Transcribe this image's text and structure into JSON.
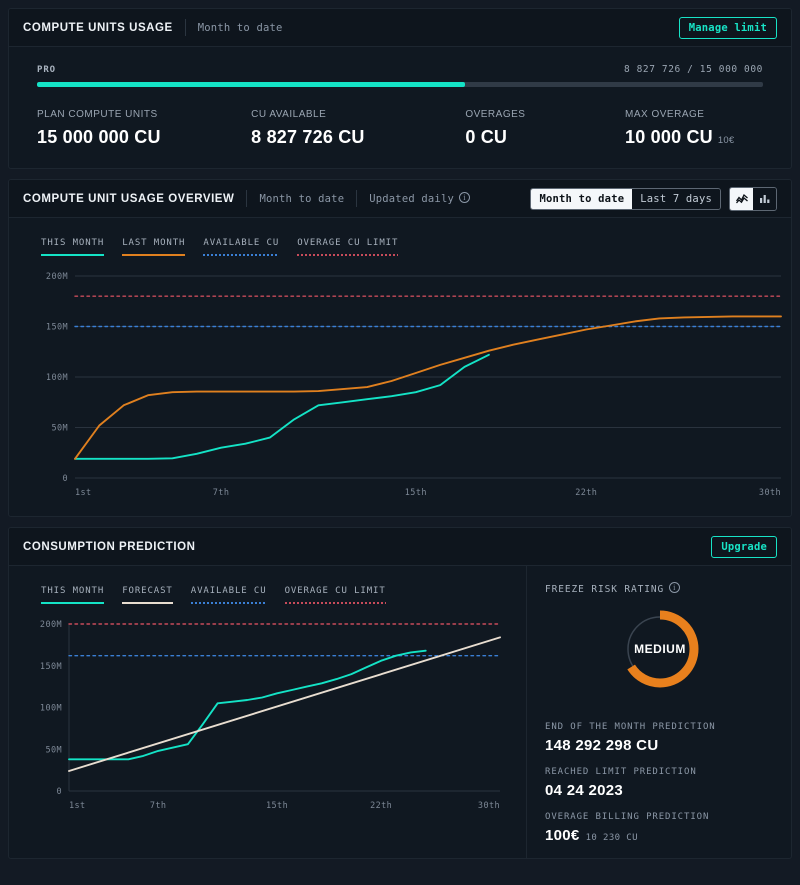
{
  "colors": {
    "teal": "#14e3c6",
    "orange": "#e0801f",
    "cream": "#e8ddd0",
    "blue_dotted": "#3a7fd5",
    "red_dotted": "#c74b5a",
    "track": "#303a46",
    "grid": "#2a333e",
    "panel_bg": "#101821",
    "page_bg": "#131a24"
  },
  "usage_panel": {
    "title": "COMPUTE UNITS USAGE",
    "subtitle": "Month to date",
    "manage_limit_label": "Manage limit",
    "plan_name": "PRO",
    "plan_count": "8 827 726 / 15 000 000",
    "progress_percent": 58.9,
    "stats": [
      {
        "label": "PLAN COMPUTE UNITS",
        "value": "15 000 000 CU",
        "suffix": ""
      },
      {
        "label": "CU AVAILABLE",
        "value": "8 827 726 CU",
        "suffix": ""
      },
      {
        "label": "OVERAGES",
        "value": "0 CU",
        "suffix": ""
      },
      {
        "label": "MAX OVERAGE",
        "value": "10 000 CU",
        "suffix": "10€"
      }
    ]
  },
  "overview_panel": {
    "title": "COMPUTE UNIT USAGE OVERVIEW",
    "subtitle": "Month to date",
    "updated_label": "Updated daily",
    "range_options": [
      "Month to date",
      "Last 7 days"
    ],
    "range_selected": "Month to date",
    "view_icons": [
      "line-chart-icon",
      "bar-chart-icon"
    ],
    "view_selected": "line-chart-icon",
    "legend": [
      {
        "label": "THIS MONTH",
        "color": "#14e3c6",
        "style": "solid"
      },
      {
        "label": "LAST MONTH",
        "color": "#e0801f",
        "style": "solid"
      },
      {
        "label": "AVAILABLE CU",
        "color": "#3a7fd5",
        "style": "dashed"
      },
      {
        "label": "OVERAGE CU LIMIT",
        "color": "#c74b5a",
        "style": "dashed"
      }
    ]
  },
  "prediction_panel": {
    "title": "CONSUMPTION PREDICTION",
    "upgrade_label": "Upgrade",
    "legend": [
      {
        "label": "THIS MONTH",
        "color": "#14e3c6",
        "style": "solid"
      },
      {
        "label": "FORECAST",
        "color": "#e8ddd0",
        "style": "solid"
      },
      {
        "label": "AVAILABLE CU",
        "color": "#3a7fd5",
        "style": "dashed"
      },
      {
        "label": "OVERAGE CU LIMIT",
        "color": "#c74b5a",
        "style": "dashed"
      }
    ],
    "freeze_risk_title": "FREEZE RISK RATING",
    "freeze_risk_value": "MEDIUM",
    "freeze_risk_percent": 66,
    "metrics": [
      {
        "label": "END OF THE MONTH PREDICTION",
        "value": "148 292 298 CU",
        "suffix": ""
      },
      {
        "label": "REACHED LIMIT PREDICTION",
        "value": "04 24 2023",
        "suffix": ""
      },
      {
        "label": "OVERAGE BILLING PREDICTION",
        "value": "100€",
        "suffix": "10 230 CU"
      }
    ]
  },
  "chart_data": [
    {
      "id": "overview",
      "type": "line",
      "title": "COMPUTE UNIT USAGE OVERVIEW",
      "xlabel": "",
      "ylabel": "",
      "xticks": [
        "1st",
        "7th",
        "15th",
        "22th",
        "30th"
      ],
      "xtick_days": [
        1,
        7,
        15,
        22,
        30
      ],
      "yticks": [
        "0",
        "50M",
        "100M",
        "150M",
        "200M"
      ],
      "ytick_values": [
        0,
        50000000,
        100000000,
        150000000,
        200000000
      ],
      "ylim": [
        0,
        200000000
      ],
      "xlim": [
        1,
        30
      ],
      "grid": true,
      "legend_position": "top-left",
      "reference_lines": [
        {
          "name": "AVAILABLE CU",
          "value": 150000000,
          "color": "#3a7fd5",
          "style": "dashed"
        },
        {
          "name": "OVERAGE CU LIMIT",
          "value": 180000000,
          "color": "#c74b5a",
          "style": "dashed"
        }
      ],
      "series": [
        {
          "name": "THIS MONTH",
          "color": "#14e3c6",
          "x": [
            1,
            2,
            3,
            4,
            5,
            6,
            7,
            8,
            9,
            10,
            11,
            12,
            13,
            14,
            15,
            16,
            17,
            18
          ],
          "values": [
            19000000,
            19000000,
            19000000,
            19000000,
            19500000,
            24000000,
            30000000,
            34000000,
            40000000,
            58000000,
            72000000,
            75000000,
            78000000,
            81000000,
            85000000,
            92000000,
            110000000,
            122000000
          ]
        },
        {
          "name": "LAST MONTH",
          "color": "#e0801f",
          "x": [
            1,
            2,
            3,
            4,
            5,
            6,
            7,
            8,
            9,
            10,
            11,
            12,
            13,
            14,
            15,
            16,
            17,
            18,
            19,
            20,
            21,
            22,
            23,
            24,
            25,
            26,
            27,
            28,
            29,
            30
          ],
          "values": [
            19000000,
            52000000,
            72000000,
            82000000,
            85000000,
            85500000,
            85500000,
            85500000,
            85500000,
            85500000,
            86000000,
            88000000,
            90000000,
            96000000,
            104000000,
            112000000,
            119000000,
            126000000,
            132000000,
            137000000,
            142000000,
            147000000,
            151000000,
            155000000,
            158000000,
            159000000,
            159500000,
            160000000,
            160000000,
            160000000
          ]
        }
      ]
    },
    {
      "id": "prediction",
      "type": "line",
      "title": "CONSUMPTION PREDICTION",
      "xlabel": "",
      "ylabel": "",
      "xticks": [
        "1st",
        "7th",
        "15th",
        "22th",
        "30th"
      ],
      "xtick_days": [
        1,
        7,
        15,
        22,
        30
      ],
      "yticks": [
        "0",
        "50M",
        "100M",
        "150M",
        "200M"
      ],
      "ytick_values": [
        0,
        50000000,
        100000000,
        150000000,
        200000000
      ],
      "ylim": [
        0,
        200000000
      ],
      "xlim": [
        1,
        30
      ],
      "grid": false,
      "legend_position": "top-left",
      "reference_lines": [
        {
          "name": "AVAILABLE CU",
          "value": 162000000,
          "color": "#3a7fd5",
          "style": "dashed"
        },
        {
          "name": "OVERAGE CU LIMIT",
          "value": 200000000,
          "color": "#c74b5a",
          "style": "dashed"
        }
      ],
      "series": [
        {
          "name": "THIS MONTH",
          "color": "#14e3c6",
          "x": [
            1,
            2,
            3,
            4,
            5,
            6,
            7,
            8,
            9,
            10,
            11,
            12,
            13,
            14,
            15,
            16,
            17,
            18,
            19,
            20,
            21,
            22,
            23,
            24,
            25
          ],
          "values": [
            38000000,
            38000000,
            38000000,
            38000000,
            38000000,
            42000000,
            48000000,
            52000000,
            56000000,
            80000000,
            105000000,
            107000000,
            109000000,
            112000000,
            117000000,
            121000000,
            125000000,
            129000000,
            134000000,
            140000000,
            148000000,
            156000000,
            162000000,
            166000000,
            168000000
          ]
        },
        {
          "name": "FORECAST",
          "color": "#e8ddd0",
          "x": [
            1,
            30
          ],
          "values": [
            24000000,
            184000000
          ]
        }
      ]
    }
  ]
}
